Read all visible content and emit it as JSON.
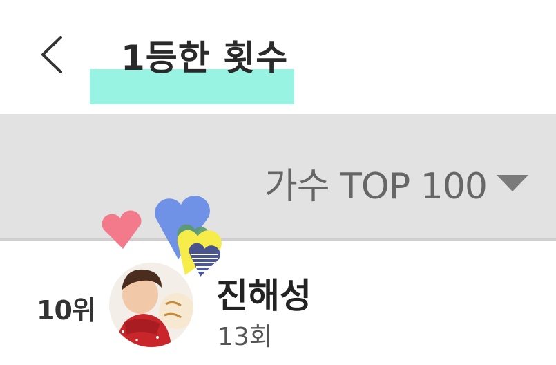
{
  "header": {
    "back_icon": "chevron-left-icon",
    "title": "1등한 횟수",
    "highlight_color": "#7ff0dc"
  },
  "filter": {
    "selected": "가수 TOP 100",
    "caret_icon": "caret-down-icon"
  },
  "ranking": [
    {
      "rank": "10위",
      "name": "진해성",
      "count": "13회",
      "avatar_icon": "artist-avatar"
    }
  ],
  "stickers": [
    "heart-pink",
    "heart-blue",
    "heart-yellow",
    "heart-green",
    "heart-striped"
  ]
}
